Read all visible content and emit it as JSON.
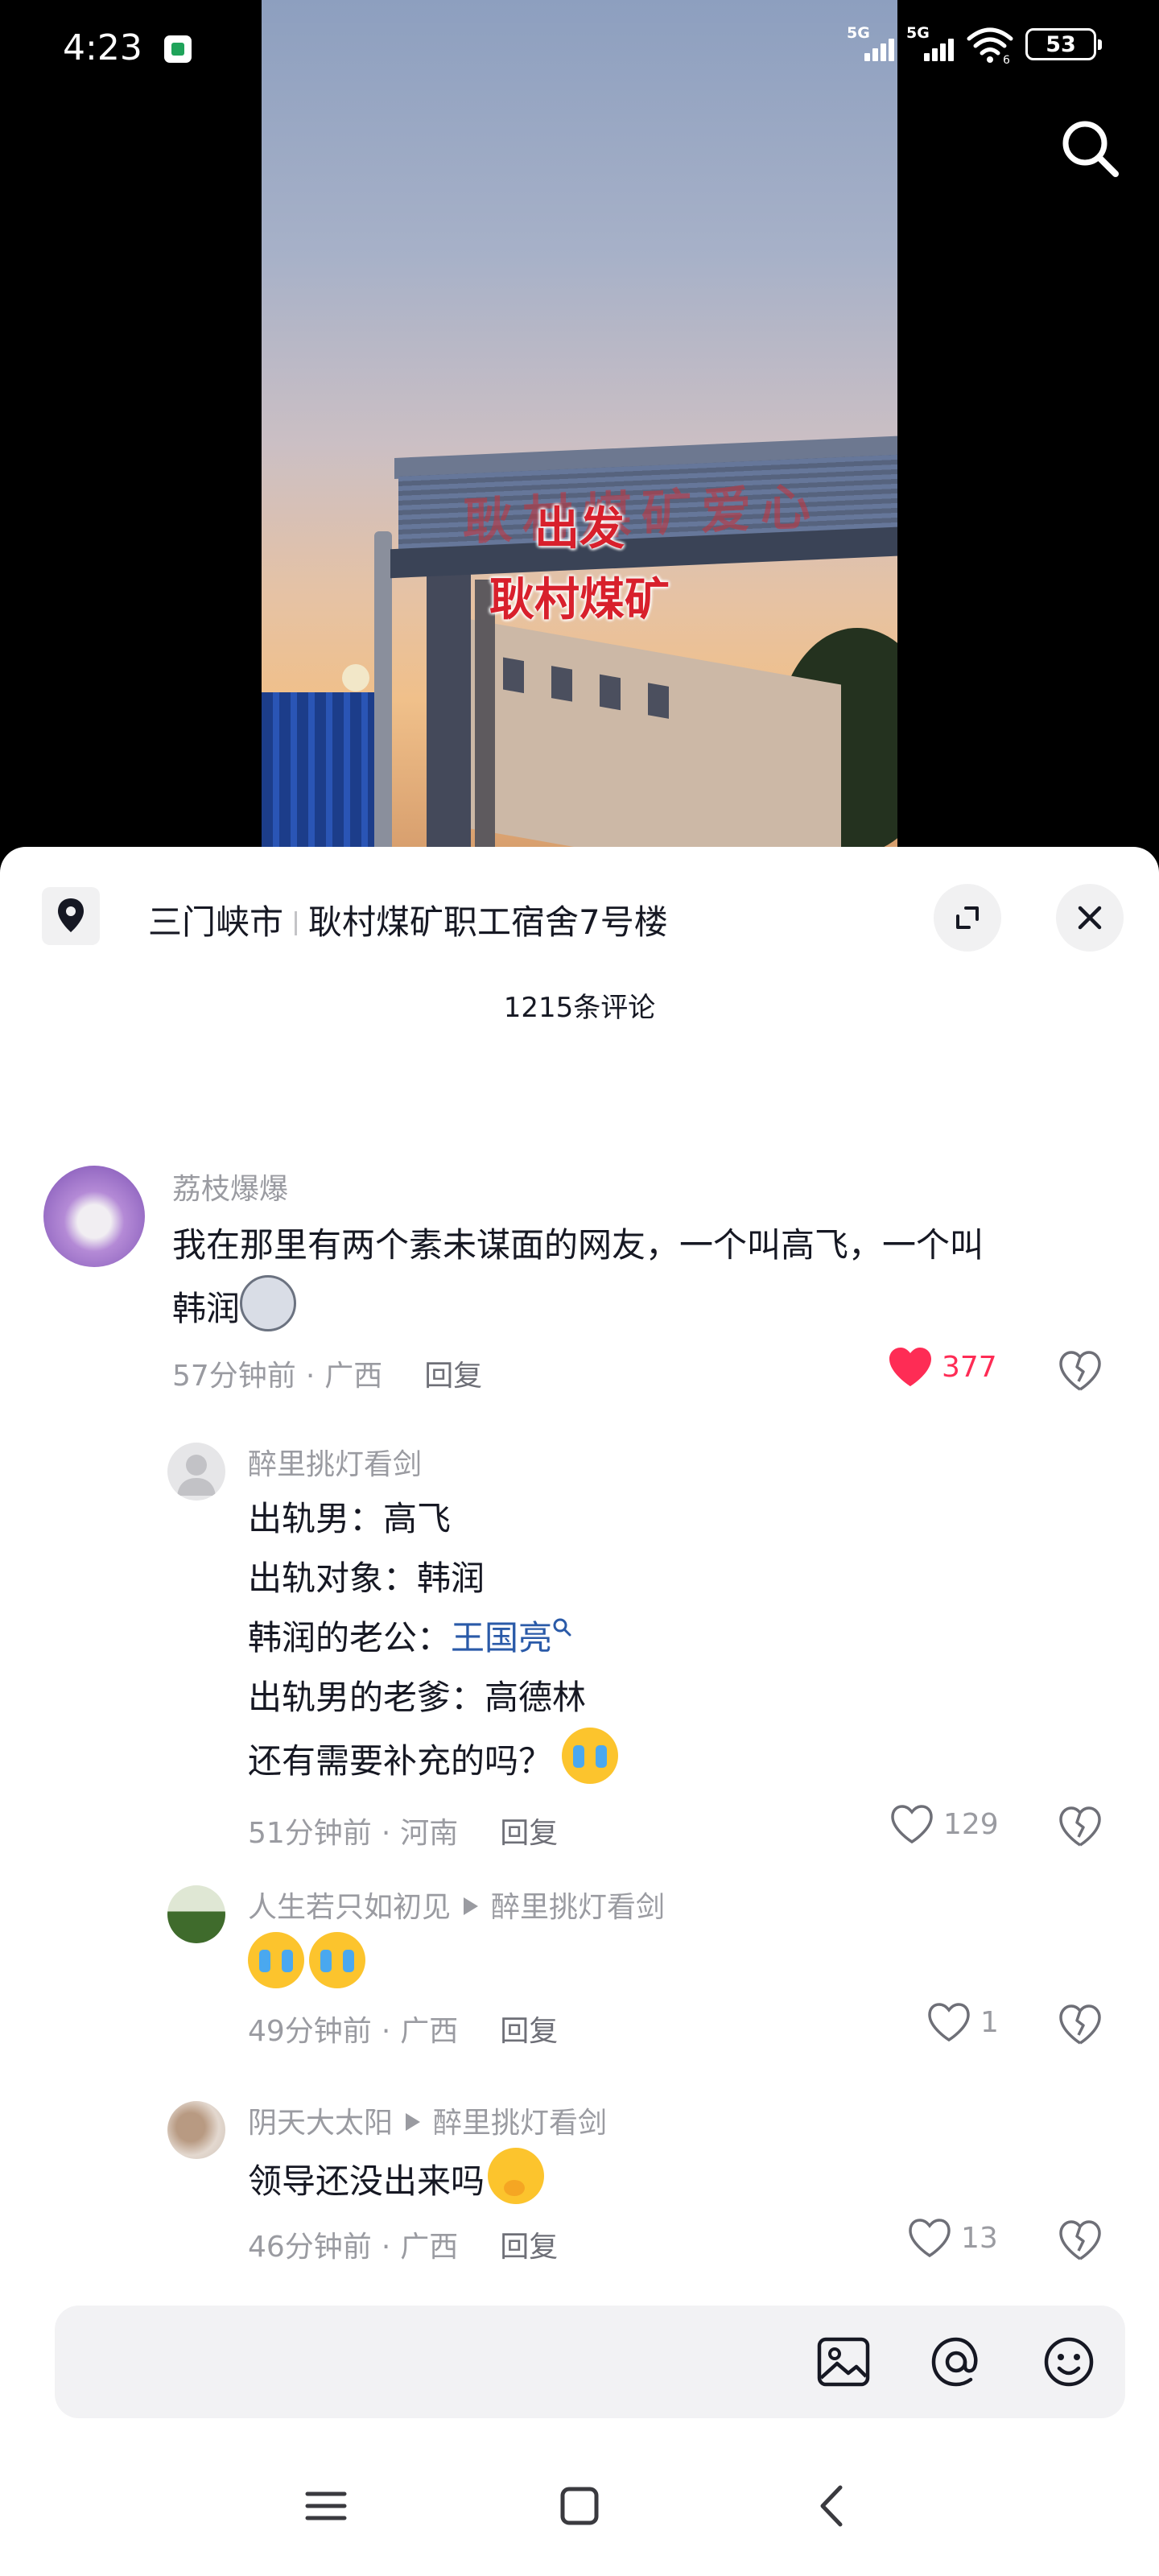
{
  "status_bar": {
    "time": "4:23",
    "signal_1_label": "5G",
    "signal_2_label": "5G",
    "wifi_label": "6",
    "battery": "53"
  },
  "video": {
    "overlay_line_1": "出发",
    "overlay_line_2": "耿村煤矿",
    "sign_text": "耿村煤矿爱心"
  },
  "location": {
    "city": "三门峡市",
    "place": "耿村煤矿职工宿舍7号楼"
  },
  "comment_count": "1215条评论",
  "comments": [
    {
      "username": "荔枝爆爆",
      "text_line_1": "我在那里有两个素未谋面的网友，一个叫高飞，一个叫",
      "text_line_2": "韩润",
      "emoji": "husky-emoji",
      "time": "57分钟前",
      "region": "广西",
      "reply_label": "回复",
      "likes": "377",
      "liked": true
    },
    {
      "username": "醉里挑灯看剑",
      "lines": [
        "出轨男：高飞",
        "出轨对象：韩润"
      ],
      "line_3_prefix": "韩润的老公：",
      "line_3_link": "王国亮",
      "line_4": "出轨男的老爹：高德林",
      "line_5": "还有需要补充的吗？",
      "emoji": "laugh-cry-emoji",
      "time": "51分钟前",
      "region": "河南",
      "reply_label": "回复",
      "likes": "129",
      "liked": false
    },
    {
      "username": "人生若只如初见",
      "reply_to": "醉里挑灯看剑",
      "emoji": "cry-emoji",
      "time": "49分钟前",
      "region": "广西",
      "reply_label": "回复",
      "likes": "1",
      "liked": false
    },
    {
      "username": "阴天大太阳",
      "reply_to": "醉里挑灯看剑",
      "text": "领导还没出来吗",
      "emoji": "shy-emoji",
      "time": "46分钟前",
      "region": "广西",
      "reply_label": "回复",
      "likes": "13",
      "liked": false
    }
  ],
  "input_bar": {
    "placeholder": "",
    "icons": [
      "image-icon",
      "at-icon",
      "emoji-icon"
    ]
  },
  "colors": {
    "like_red": "#fe2c55",
    "meta_gray": "#9a9ba1",
    "link_blue": "#2a5aa8",
    "text_dark": "#161823"
  }
}
